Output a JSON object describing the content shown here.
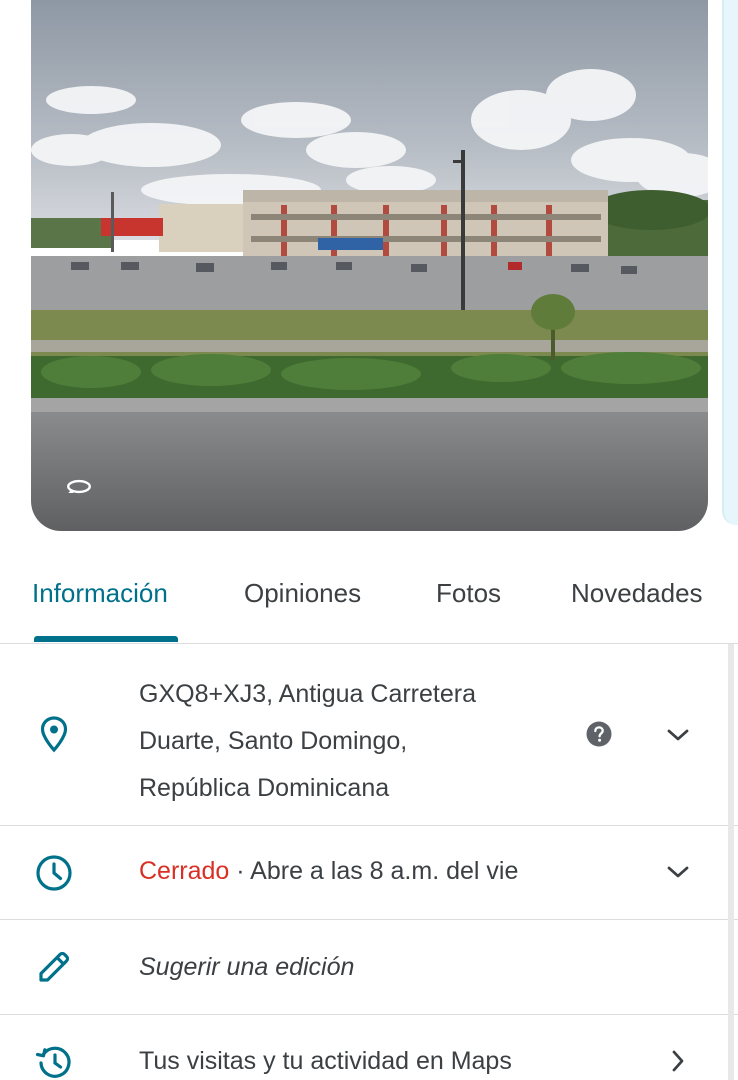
{
  "photo": {
    "streetview_icon": "street-view-rotate-icon",
    "sky_color": "#9aa3ad",
    "road_color": "#6f7072"
  },
  "tabs": [
    {
      "label": "Información",
      "active": true
    },
    {
      "label": "Opiniones",
      "active": false
    },
    {
      "label": "Fotos",
      "active": false
    },
    {
      "label": "Novedades",
      "active": false
    }
  ],
  "address": {
    "icon": "location-pin-icon",
    "lines": [
      "GXQ8+XJ3, Antigua Carretera",
      "Duarte, Santo Domingo,",
      "República Dominicana"
    ],
    "help_icon": "help-circle-icon",
    "expand_icon": "chevron-down-icon"
  },
  "hours": {
    "icon": "clock-icon",
    "status": "Cerrado",
    "detail": " · Abre a las 8 a.m. del vie",
    "expand_icon": "chevron-down-icon"
  },
  "edit": {
    "icon": "pencil-icon",
    "label": "Sugerir una edición"
  },
  "visits": {
    "icon": "history-icon",
    "label": "Tus visitas y tu actividad en Maps",
    "next_icon": "chevron-right-icon"
  },
  "colors": {
    "accent": "#00718a",
    "closed": "#d93025",
    "text": "#3c4043",
    "divider": "#dadce0"
  }
}
